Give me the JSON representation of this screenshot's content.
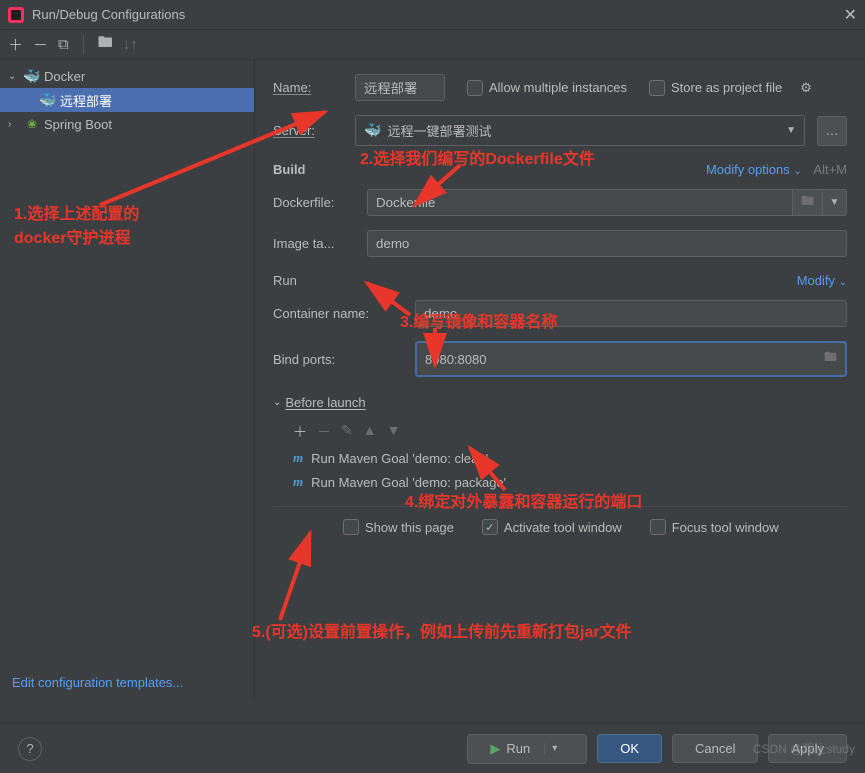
{
  "window": {
    "title": "Run/Debug Configurations"
  },
  "tree": {
    "docker": "Docker",
    "docker_child": "远程部署",
    "spring": "Spring Boot"
  },
  "sidebar": {
    "edit_templates": "Edit configuration templates..."
  },
  "form": {
    "name_label": "Name:",
    "name_value": "远程部署",
    "allow_multiple": "Allow multiple instances",
    "store_project": "Store as project file",
    "server_label": "Server:",
    "server_value": "远程一键部署测试",
    "build_title": "Build",
    "modify_options": "Modify options",
    "modify_hint": "Alt+M",
    "dockerfile_label": "Dockerfile:",
    "dockerfile_value": "Dockerfile",
    "image_tag_label": "Image ta...",
    "image_tag_value": "demo",
    "run_title": "Run",
    "modify": "Modify",
    "container_label": "Container name:",
    "container_value": "demo",
    "bind_ports_label": "Bind ports:",
    "bind_ports_value": "8080:8080",
    "before_launch": "Before launch",
    "bl_item1": "Run Maven Goal 'demo: clean'",
    "bl_item2": "Run Maven Goal 'demo: package'",
    "show_page": "Show this page",
    "activate_tool": "Activate tool window",
    "focus_tool": "Focus tool window"
  },
  "annotations": {
    "a1_line1": "1.选择上述配置的",
    "a1_line2": "docker守护进程",
    "a2": "2.选择我们编写的Dockerfile文件",
    "a3": "3.编写镜像和容器名称",
    "a4": "4.绑定对外暴露和容器运行的端口",
    "a5": "5.(可选)设置前置操作，例如上传前先重新打包jar文件"
  },
  "buttons": {
    "run": "Run",
    "ok": "OK",
    "cancel": "Cancel",
    "apply": "Apply"
  },
  "watermark": "CSDN @观止study"
}
